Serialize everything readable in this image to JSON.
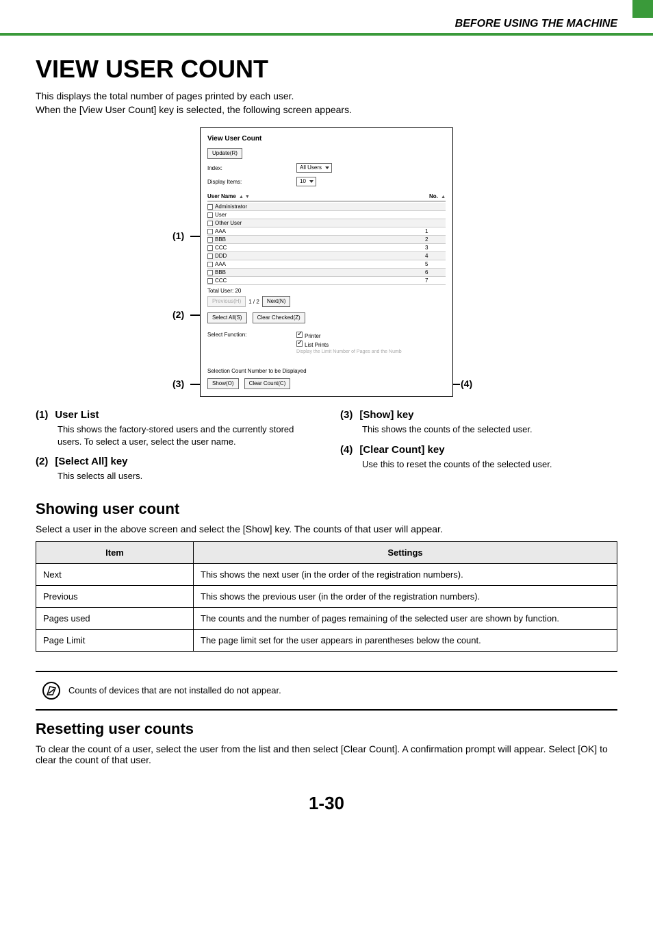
{
  "header": {
    "section_title": "BEFORE USING THE MACHINE"
  },
  "title": "VIEW USER COUNT",
  "intro_line1": "This displays the total number of pages printed by each user.",
  "intro_line2": "When the [View User Count] key is selected, the following screen appears.",
  "screenshot": {
    "title": "View User Count",
    "update_btn": "Update(R)",
    "index_label": "Index:",
    "index_value": "All Users",
    "display_items_label": "Display Items:",
    "display_items_value": "10",
    "col_user": "User Name",
    "col_user_arrows": "▲ ▼",
    "col_no": "No.",
    "col_no_arrows": "▲",
    "rows": [
      {
        "name": "Administrator",
        "no": ""
      },
      {
        "name": "User",
        "no": ""
      },
      {
        "name": "Other User",
        "no": ""
      },
      {
        "name": "AAA",
        "no": "1"
      },
      {
        "name": "BBB",
        "no": "2"
      },
      {
        "name": "CCC",
        "no": "3"
      },
      {
        "name": "DDD",
        "no": "4"
      },
      {
        "name": "AAA",
        "no": "5"
      },
      {
        "name": "BBB",
        "no": "6"
      },
      {
        "name": "CCC",
        "no": "7"
      }
    ],
    "total_user": "Total User:  20",
    "prev_btn": "Previous(H)",
    "page_indicator": "1 / 2",
    "next_btn": "Next(N)",
    "select_all_btn": "Select All(S)",
    "clear_checked_btn": "Clear Checked(Z)",
    "select_function_label": "Select Function:",
    "sf_printer": "Printer",
    "sf_list": "List Prints",
    "sf_note": "Display the Limit Number of Pages and the Numb",
    "sel_counter_label": "Selection Count Number to be Displayed",
    "show_btn": "Show(O)",
    "clear_count_btn": "Clear Count(C)"
  },
  "callouts": {
    "c1": "(1)",
    "c2": "(2)",
    "c3": "(3)",
    "c4": "(4)"
  },
  "descriptions": {
    "d1_num": "(1)",
    "d1_title": "User List",
    "d1_body": "This shows the factory-stored users and the currently stored users. To select a user, select the user name.",
    "d2_num": "(2)",
    "d2_title": "[Select All] key",
    "d2_body": "This selects all users.",
    "d3_num": "(3)",
    "d3_title": "[Show] key",
    "d3_body": "This shows the counts of the selected user.",
    "d4_num": "(4)",
    "d4_title": "[Clear Count] key",
    "d4_body": "Use this to reset the counts of the selected user."
  },
  "showing": {
    "heading": "Showing user count",
    "intro": "Select a user in the above screen and select the [Show] key. The counts of that user will appear.",
    "th_item": "Item",
    "th_settings": "Settings",
    "rows": [
      {
        "item": "Next",
        "settings": "This shows the next user (in the order of the registration numbers)."
      },
      {
        "item": "Previous",
        "settings": "This shows the previous user (in the order of the registration numbers)."
      },
      {
        "item": "Pages used",
        "settings": "The counts and the number of pages remaining of the selected user are shown by function."
      },
      {
        "item": "Page Limit",
        "settings": "The page limit set for the user appears in parentheses below the count."
      }
    ]
  },
  "note": "Counts of devices that are not installed do not appear.",
  "resetting": {
    "heading": "Resetting user counts",
    "body": "To clear the count of a user, select the user from the list and then select [Clear Count]. A confirmation prompt will appear. Select [OK] to clear the count of that user."
  },
  "page_number": "1-30"
}
